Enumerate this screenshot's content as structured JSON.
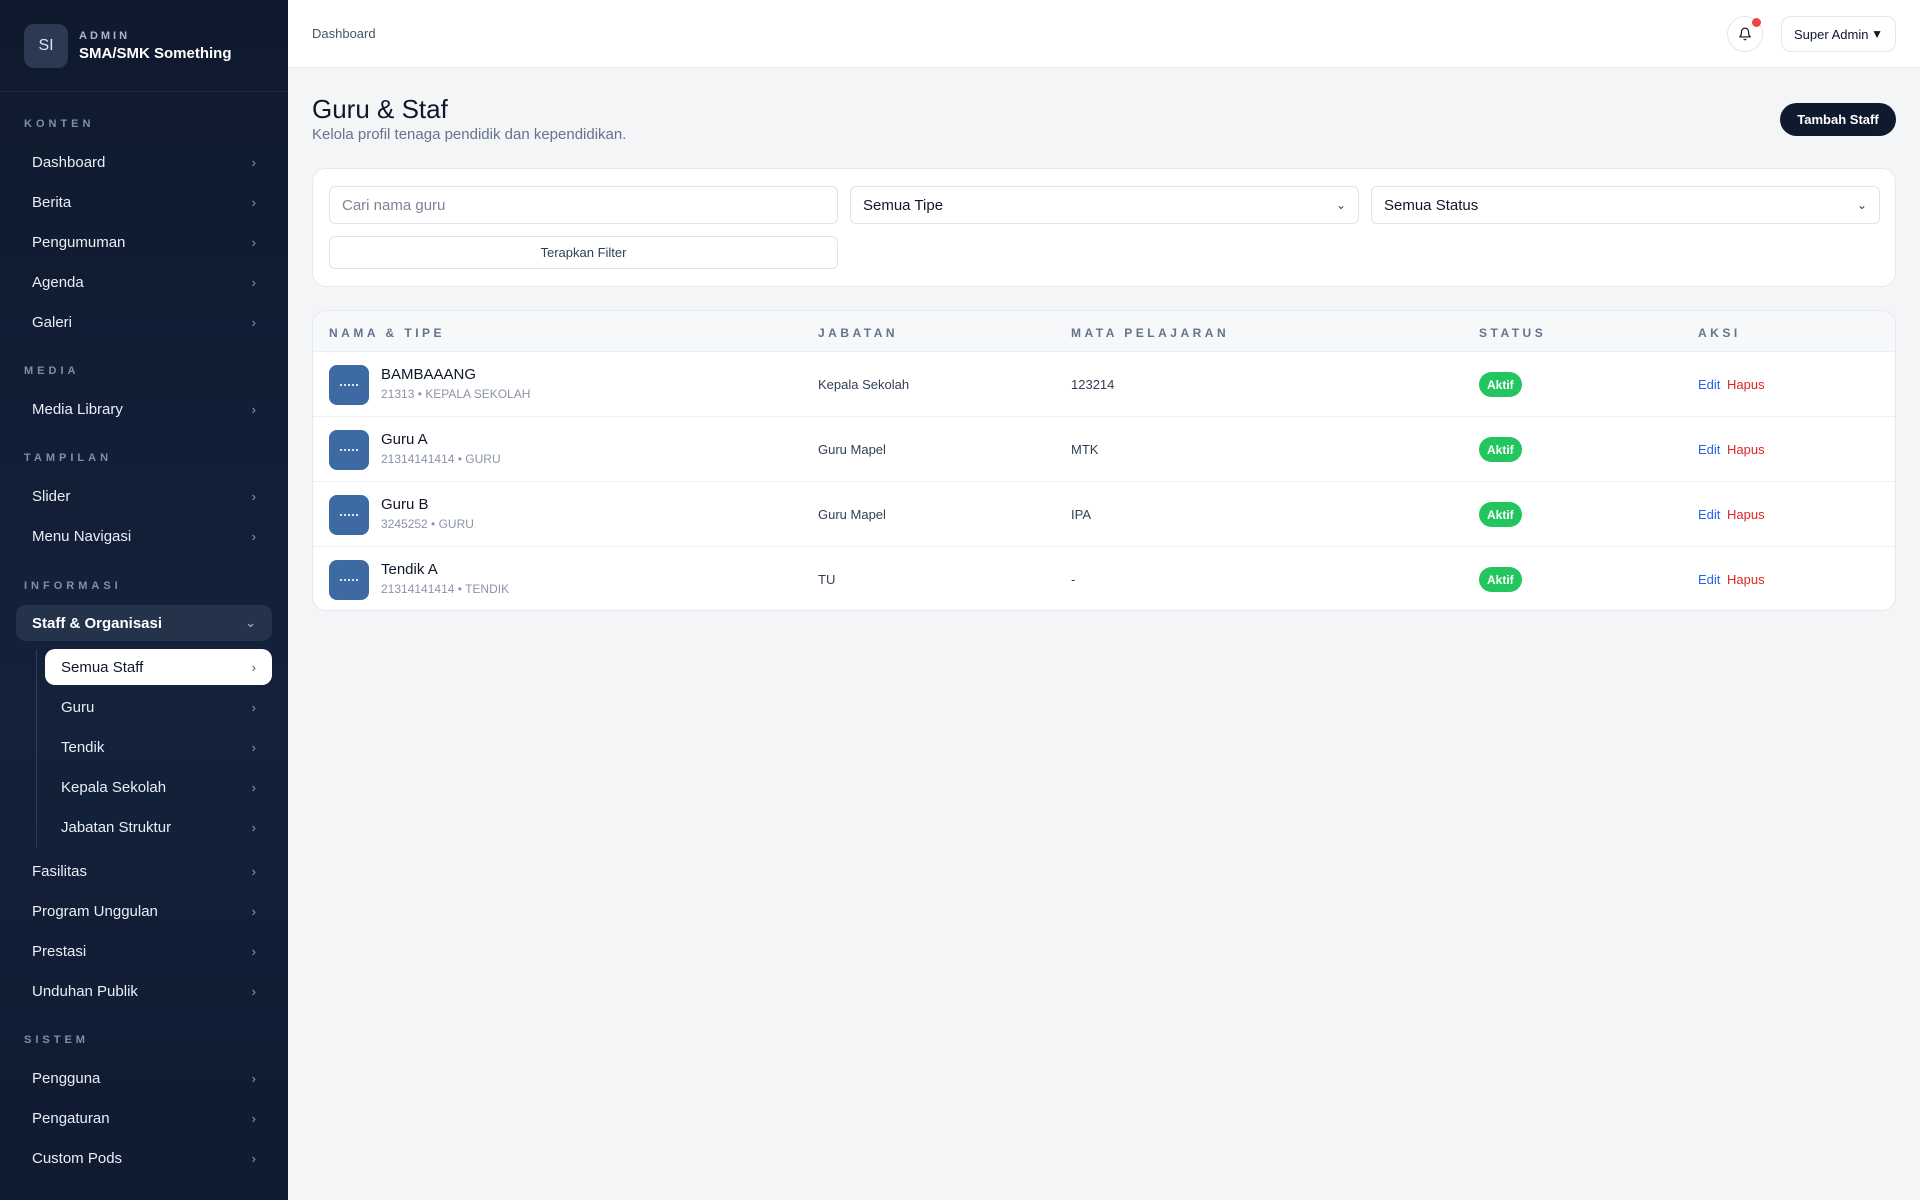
{
  "brand": {
    "initials": "SI",
    "role": "ADMIN",
    "name": "SMA/SMK Something"
  },
  "sidebar": {
    "sections": {
      "konten": "KONTEN",
      "media": "MEDIA",
      "tampilan": "TAMPILAN",
      "informasi": "INFORMASI",
      "sistem": "SISTEM"
    },
    "konten_items": [
      "Dashboard",
      "Berita",
      "Pengumuman",
      "Agenda",
      "Galeri"
    ],
    "media_items": [
      "Media Library"
    ],
    "tampilan_items": [
      "Slider",
      "Menu Navigasi"
    ],
    "informasi_open": "Staff & Organisasi",
    "informasi_sub": [
      "Semua Staff",
      "Guru",
      "Tendik",
      "Kepala Sekolah",
      "Jabatan Struktur"
    ],
    "informasi_items": [
      "Fasilitas",
      "Program Unggulan",
      "Prestasi",
      "Unduhan Publik"
    ],
    "sistem_items": [
      "Pengguna",
      "Pengaturan",
      "Custom Pods"
    ],
    "chevron": "›",
    "chevron_down": "⌄"
  },
  "topbar": {
    "breadcrumb": "Dashboard",
    "user": "Super Admin",
    "user_caret": "▼"
  },
  "page": {
    "title": "Guru & Staf",
    "subtitle": "Kelola profil tenaga pendidik dan kependidikan.",
    "add_button": "Tambah Staff"
  },
  "filters": {
    "search_placeholder": "Cari nama guru",
    "type_value": "Semua Tipe",
    "status_value": "Semua Status",
    "apply_label": "Terapkan Filter",
    "dropdown_glyph": "⌄"
  },
  "table": {
    "headers": [
      "NAMA & TIPE",
      "JABATAN",
      "MATA PELAJARAN",
      "STATUS",
      "AKSI"
    ],
    "rows": [
      {
        "name": "BAMBAAANG",
        "meta": "21313 • KEPALA SEKOLAH",
        "jabatan": "Kepala Sekolah",
        "mapel": "123214",
        "status": "Aktif",
        "edit": "Edit",
        "delete": "Hapus"
      },
      {
        "name": "Guru A",
        "meta": "21314141414 • GURU",
        "jabatan": "Guru Mapel",
        "mapel": "MTK",
        "status": "Aktif",
        "edit": "Edit",
        "delete": "Hapus"
      },
      {
        "name": "Guru B",
        "meta": "3245252 • GURU",
        "jabatan": "Guru Mapel",
        "mapel": "IPA",
        "status": "Aktif",
        "edit": "Edit",
        "delete": "Hapus"
      },
      {
        "name": "Tendik A",
        "meta": "21314141414 • TENDIK",
        "jabatan": "TU",
        "mapel": "-",
        "status": "Aktif",
        "edit": "Edit",
        "delete": "Hapus"
      }
    ]
  },
  "colors": {
    "sidebar_bg": "#0f1a2e",
    "primary": "#0f1a2e",
    "status_active": "#22c55e",
    "edit_link": "#2563eb",
    "delete_link": "#dc2626",
    "notification_dot": "#ef4444"
  }
}
